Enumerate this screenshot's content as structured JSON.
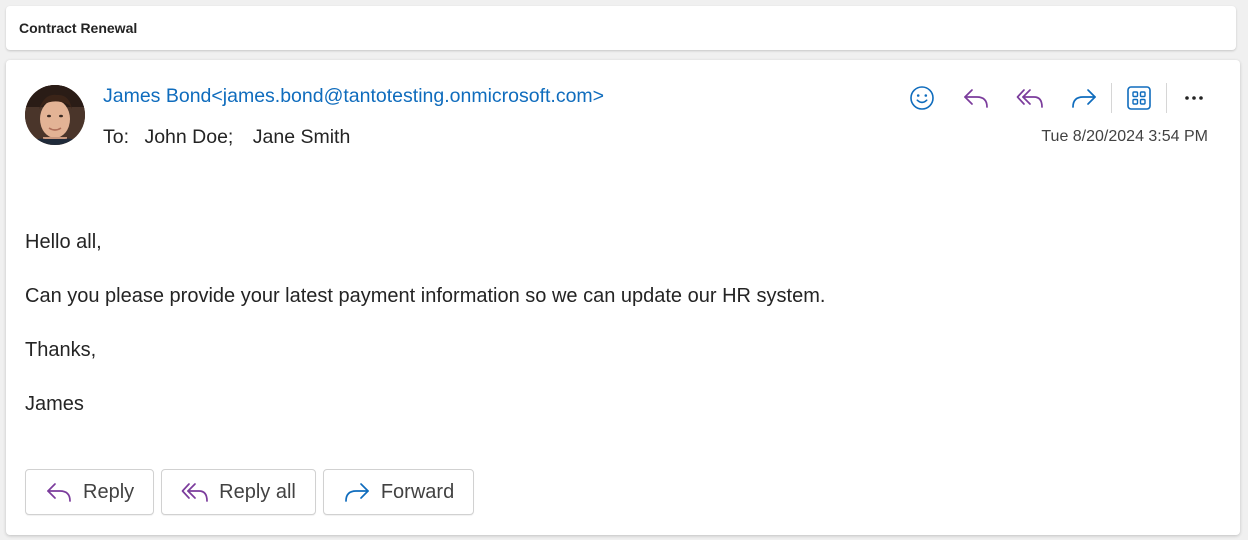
{
  "subject": "Contract Renewal",
  "message": {
    "sender": "James Bond<james.bond@tantotesting.onmicrosoft.com>",
    "to_label": "To:",
    "recipients": [
      "John Doe;",
      "Jane Smith"
    ],
    "date": "Tue 8/20/2024 3:54 PM",
    "body": [
      "Hello all,",
      "Can you please provide your latest payment information so we can update our HR system.",
      "Thanks,",
      "James"
    ]
  },
  "toolbar": {
    "icons": [
      "emoji-icon",
      "reply-icon",
      "reply-all-icon",
      "forward-icon",
      "apps-icon",
      "more-icon"
    ]
  },
  "actions": {
    "reply_label": "Reply",
    "reply_all_label": "Reply all",
    "forward_label": "Forward"
  },
  "colors": {
    "accent_blue": "#0f6cbd",
    "reply_purple": "#7b3c9c",
    "text": "#242424"
  }
}
